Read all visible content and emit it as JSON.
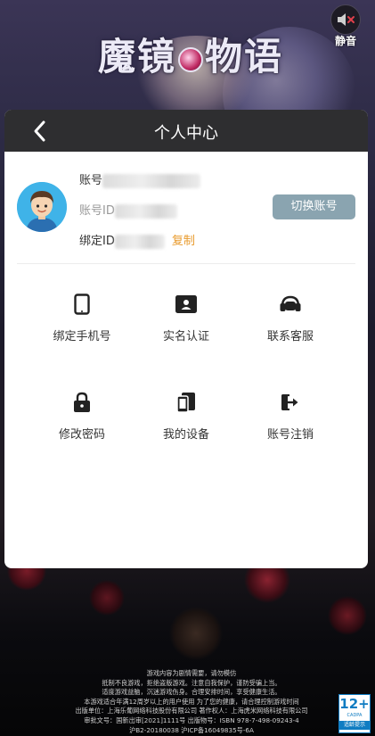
{
  "game": {
    "logo_text_left": "魔镜",
    "logo_text_right": "物语"
  },
  "mute": {
    "label": "静音",
    "icon": "speaker-muted-icon"
  },
  "panel": {
    "title": "个人中心",
    "back_icon": "chevron-left-icon",
    "profile": {
      "account_label": "账号",
      "account_id_label": "账号ID",
      "bind_id_label": "绑定ID",
      "copy_label": "复制",
      "switch_label": "切换账号"
    },
    "grid": [
      {
        "label": "绑定手机号",
        "icon": "phone-icon"
      },
      {
        "label": "实名认证",
        "icon": "id-card-icon"
      },
      {
        "label": "联系客服",
        "icon": "headset-icon"
      },
      {
        "label": "修改密码",
        "icon": "lock-icon"
      },
      {
        "label": "我的设备",
        "icon": "devices-icon"
      },
      {
        "label": "账号注销",
        "icon": "logout-icon"
      }
    ]
  },
  "footer": {
    "lines": [
      "游戏内容为剧情需要，请勿模仿",
      "抵制不良游戏，拒绝盗版游戏。注意自我保护，谨防受骗上当。",
      "适度游戏益脑，沉迷游戏伤身。合理安排时间，享受健康生活。",
      "本游戏适合年满12周岁以上的用户使用 为了您的健康，请合理控制游戏时间",
      "出版单位：上海乐葡网络科技股份有限公司 著作权人：上海虎米网络科技有限公司",
      "审批文号：国新出审[2021]1111号 出版物号：ISBN 978-7-498-09243-4",
      "沪B2-20180038 沪ICP备16049835号-6A"
    ]
  },
  "age_rating": {
    "number": "12+",
    "sub": "CADPA",
    "tip": "适龄提示"
  },
  "colors": {
    "accent_orange": "#e89a2c",
    "switch_button": "#8aa4b0",
    "header": "#2e2e30",
    "age_blue": "#0f7cc2"
  }
}
